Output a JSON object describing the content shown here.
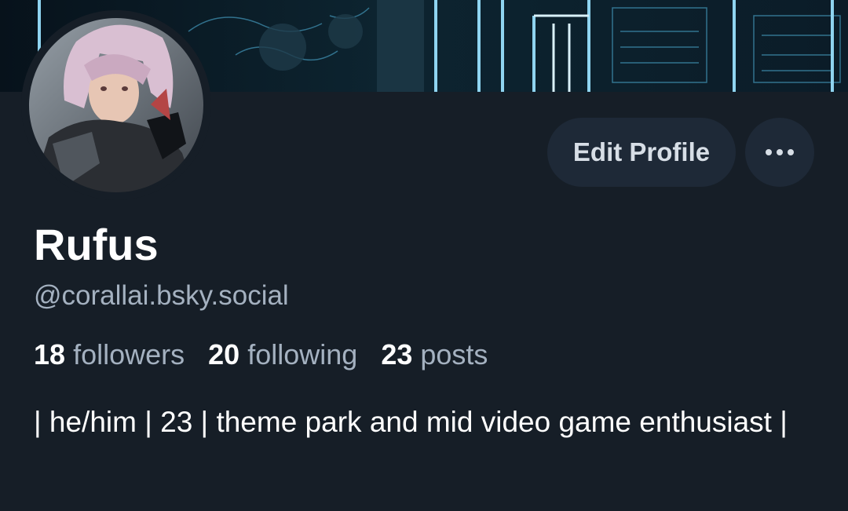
{
  "profile": {
    "display_name": "Rufus",
    "handle": "@corallai.bsky.social",
    "bio": "| he/him | 23 | theme park and mid video game enthusiast |",
    "stats": {
      "followers_count": "18",
      "followers_label": "followers",
      "following_count": "20",
      "following_label": "following",
      "posts_count": "23",
      "posts_label": "posts"
    }
  },
  "actions": {
    "edit_profile_label": "Edit Profile",
    "more_icon": "ellipsis-icon"
  },
  "images": {
    "banner": "banner-image",
    "avatar": "avatar-image"
  },
  "colors": {
    "background": "#161e27",
    "button_bg": "#1e2937",
    "secondary_text": "#a4b1c0",
    "primary_text": "#ffffff"
  }
}
